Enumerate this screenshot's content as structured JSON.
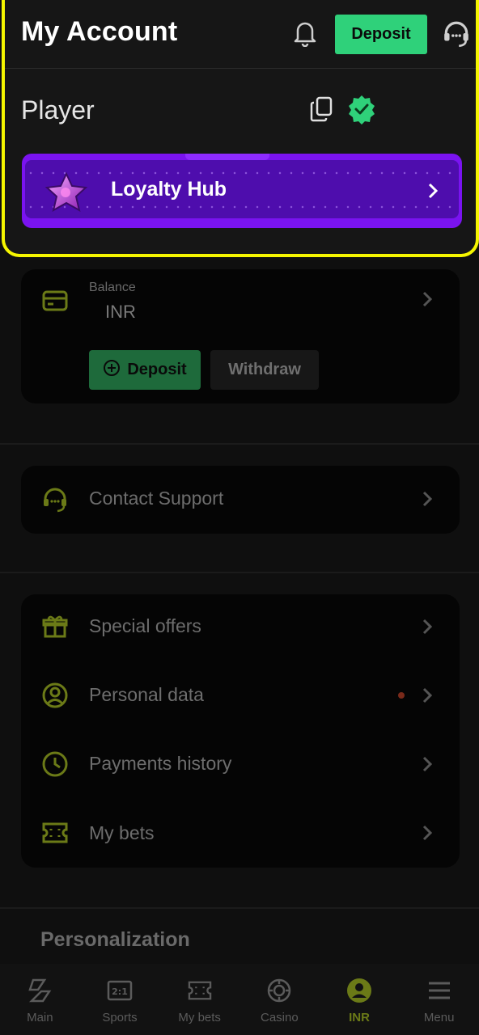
{
  "header": {
    "title": "My Account",
    "deposit_label": "Deposit"
  },
  "profile": {
    "name": "Player",
    "loyalty_label": "Loyalty Hub"
  },
  "balance": {
    "label": "Balance",
    "value": "INR",
    "deposit_label": "Deposit",
    "withdraw_label": "Withdraw"
  },
  "support": {
    "label": "Contact Support"
  },
  "menu": {
    "items": [
      {
        "label": "Special offers",
        "icon": "gift-icon"
      },
      {
        "label": "Personal data",
        "icon": "user-circle-icon",
        "has_dot": true
      },
      {
        "label": "Payments history",
        "icon": "clock-icon"
      },
      {
        "label": "My bets",
        "icon": "ticket-icon"
      }
    ]
  },
  "personalization": {
    "title": "Personalization"
  },
  "nav": {
    "items": [
      {
        "label": "Main",
        "icon": "main-icon"
      },
      {
        "label": "Sports",
        "icon": "sports-icon"
      },
      {
        "label": "My bets",
        "icon": "ticket-icon"
      },
      {
        "label": "Casino",
        "icon": "casino-chip-icon"
      },
      {
        "label": "INR",
        "icon": "account-icon",
        "active": true
      },
      {
        "label": "Menu",
        "icon": "hamburger-icon"
      }
    ]
  },
  "colors": {
    "accent_green": "#2fd17a",
    "highlight_yellow": "#f5f500",
    "loyalty_purple": "#7a13f0",
    "icon_olive": "#6b7a17"
  }
}
